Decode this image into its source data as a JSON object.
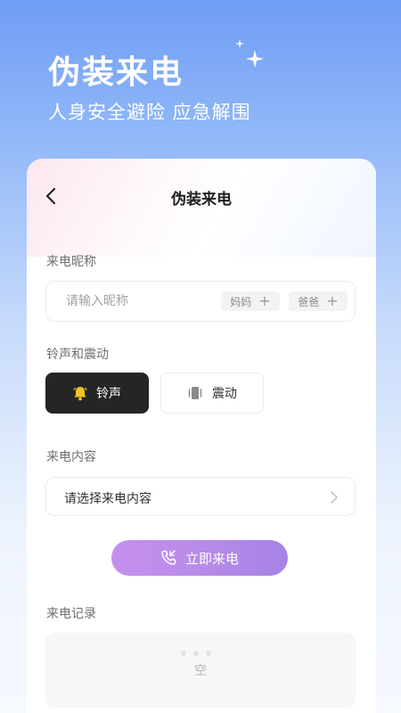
{
  "header": {
    "title": "伪装来电",
    "subtitle": "人身安全避险 应急解围"
  },
  "nav": {
    "back_icon": "chevron-left-icon",
    "title": "伪装来电"
  },
  "nickname": {
    "label": "来电昵称",
    "placeholder": "请输入昵称",
    "value": "",
    "presets": [
      "妈妈",
      "爸爸"
    ]
  },
  "alert_mode": {
    "label": "铃声和震动",
    "options": [
      {
        "label": "铃声",
        "icon": "bell-icon",
        "selected": true
      },
      {
        "label": "震动",
        "icon": "vibrate-icon",
        "selected": false
      }
    ]
  },
  "call_content": {
    "label": "来电内容",
    "placeholder": "请选择来电内容"
  },
  "call_button": {
    "label": "立即来电",
    "icon": "phone-icon"
  },
  "records": {
    "label": "来电记录",
    "empty_text": "空"
  },
  "colors": {
    "accent_start": "#c590ef",
    "accent_end": "#a583e6",
    "selected_bg": "#252525",
    "bell": "#f5c323"
  }
}
